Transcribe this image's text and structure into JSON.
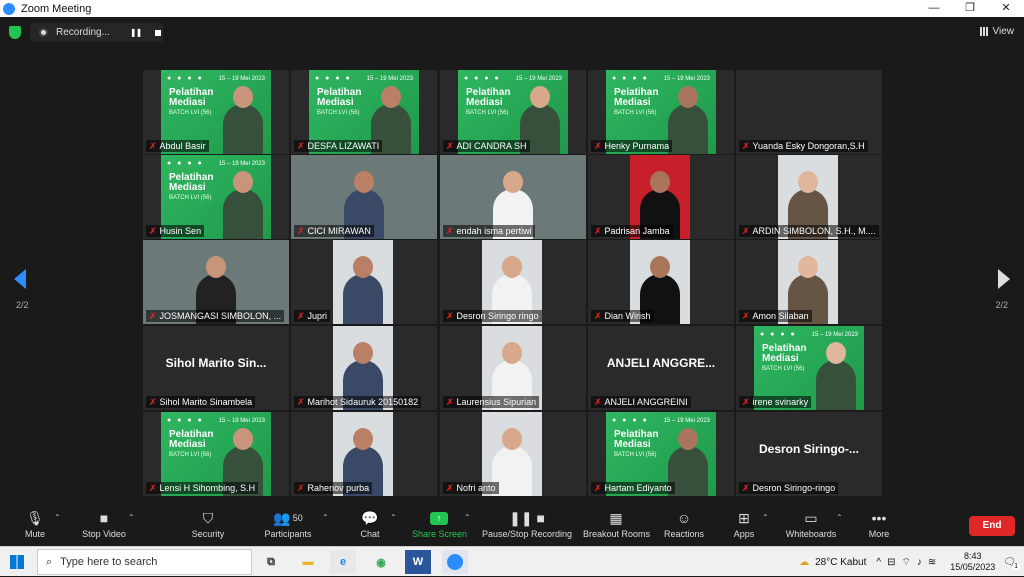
{
  "window": {
    "title": "Zoom Meeting",
    "controls": [
      "—",
      "❐",
      "✕"
    ]
  },
  "recording": {
    "label": "Recording..."
  },
  "view": {
    "label": "View"
  },
  "banner": {
    "title_line1": "Pelatihan",
    "title_line2": "Mediasi",
    "subtitle": "BATCH LVI (56)",
    "date": "15 – 19 Mei 2023",
    "logos": "● ● ● ●"
  },
  "pagination": {
    "left": "2/2",
    "right": "2/2"
  },
  "participants": [
    {
      "name": "Abdul Basir",
      "kind": "banner"
    },
    {
      "name": "DESFA LIZAWATI",
      "kind": "banner"
    },
    {
      "name": "ADI CANDRA SH",
      "kind": "banner"
    },
    {
      "name": "Henky Purnama",
      "kind": "banner"
    },
    {
      "name": "Yuanda Esky Dongoran,S.H",
      "kind": "off"
    },
    {
      "name": "Husin Sen",
      "kind": "banner"
    },
    {
      "name": "CICI MIRAWAN",
      "kind": "video"
    },
    {
      "name": "endah isma pertiwi",
      "kind": "video"
    },
    {
      "name": "Padrisan Jamba",
      "kind": "photo-red"
    },
    {
      "name": "ARDIN SIMBOLON, S.H., M....",
      "kind": "photo"
    },
    {
      "name": "JOSMANGASI SIMBOLON, ...",
      "kind": "video"
    },
    {
      "name": "Jupri",
      "kind": "photo"
    },
    {
      "name": "Desron Siringo ringo",
      "kind": "photo"
    },
    {
      "name": "Dian Wirish",
      "kind": "photo"
    },
    {
      "name": "Amon Silaban",
      "kind": "photo"
    },
    {
      "name": "Sihol Marito Sinambela",
      "kind": "text",
      "display": "Sihol  Marito  Sin..."
    },
    {
      "name": "Marihot Sidauruk 20150182",
      "kind": "photo"
    },
    {
      "name": "Laurensius Sipurian",
      "kind": "photo"
    },
    {
      "name": "ANJELI ANGGREINI",
      "kind": "text",
      "display": "ANJELI  ANGGRE..."
    },
    {
      "name": "irene svinarky",
      "kind": "banner"
    },
    {
      "name": "Lensi H Sihombing, S.H",
      "kind": "banner"
    },
    {
      "name": "Rahenov purba",
      "kind": "photo"
    },
    {
      "name": "Nofri anto",
      "kind": "photo"
    },
    {
      "name": "Hartam Ediyanto",
      "kind": "banner"
    },
    {
      "name": "Desron Siringo-ringo",
      "kind": "text",
      "display": "Desron  Siringo-..."
    }
  ],
  "toolbar": {
    "mute": "Mute",
    "stop_video": "Stop Video",
    "security": "Security",
    "participants": "Participants",
    "participants_count": "50",
    "chat": "Chat",
    "share_screen": "Share Screen",
    "pause_stop_recording": "Pause/Stop Recording",
    "breakout_rooms": "Breakout Rooms",
    "reactions": "Reactions",
    "apps": "Apps",
    "whiteboards": "Whiteboards",
    "more": "More",
    "end": "End"
  },
  "taskbar": {
    "search_placeholder": "Type here to search",
    "weather": "28°C  Kabut",
    "time": "8:43",
    "date": "15/05/2023",
    "notification_count": "1"
  },
  "colors": {
    "accent": "#2d8cff",
    "end": "#e02828",
    "share": "#23c552",
    "banner": "#2fb660",
    "mic_off": "#ee2222"
  }
}
